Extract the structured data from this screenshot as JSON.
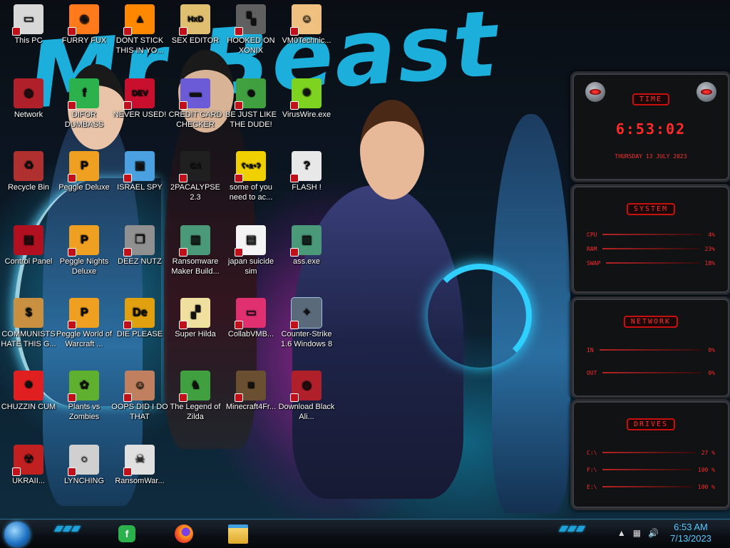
{
  "wallpaper": {
    "headline": "Mr Beast"
  },
  "desktop_icons": [
    {
      "label": "This PC",
      "icon": "computer-icon",
      "color": "#d8d8d8"
    },
    {
      "label": "FURRY FUX",
      "icon": "firefox-icon",
      "color": "#ff7a1a"
    },
    {
      "label": "DONT STICK THIS IN YO...",
      "icon": "vlc-cone-icon",
      "color": "#ff8800"
    },
    {
      "label": "SEX EDITOR",
      "icon": "hex-editor-icon",
      "color": "#e0c070"
    },
    {
      "label": "HOOKED ON XONIX",
      "icon": "xonix-game-icon",
      "color": "#606060"
    },
    {
      "label": "VM0Technic...",
      "icon": "doctor-person-icon",
      "color": "#f0c080"
    },
    {
      "label": "Network",
      "icon": "alienware-network-icon",
      "color": "#b0202a"
    },
    {
      "label": "DIFOR DUMBASS",
      "icon": "feedly-icon",
      "color": "#2bb24c"
    },
    {
      "label": "NEVER USED!",
      "icon": "dev-cpp-icon",
      "color": "#c8102e"
    },
    {
      "label": "CREDIT CARD CHECKER",
      "icon": "credit-card-window-icon",
      "color": "#6b5bd6"
    },
    {
      "label": "BE JUST LIKE THE DUDE!",
      "icon": "santa-icon",
      "color": "#40a040"
    },
    {
      "label": "VirusWire.exe",
      "icon": "lime-icon",
      "color": "#7ed321"
    },
    {
      "label": "Recycle Bin",
      "icon": "recycle-bin-icon",
      "color": "#b03030"
    },
    {
      "label": "Peggle Deluxe",
      "icon": "peggle-icon",
      "color": "#f0a020"
    },
    {
      "label": "ISRAEL SPY",
      "icon": "spy-window-icon",
      "color": "#4aa0e0"
    },
    {
      "label": "2PACALYPSE 2.3",
      "icon": "terminal-icon",
      "color": "#202020"
    },
    {
      "label": "some of you need to ac...",
      "icon": "bear-icon",
      "color": "#f0d000"
    },
    {
      "label": "FLASH !",
      "icon": "flash-document-icon",
      "color": "#e8e8e8"
    },
    {
      "label": "Control Panel",
      "icon": "control-panel-icon",
      "color": "#b01020"
    },
    {
      "label": "Peggle Nights Deluxe",
      "icon": "peggle-nights-icon",
      "color": "#f0a020"
    },
    {
      "label": "DEEZ NUTZ",
      "icon": "stacked-windows-icon",
      "color": "#909090"
    },
    {
      "label": "Ransomware Maker Build...",
      "icon": "ransomware-window-icon",
      "color": "#4a9a7a"
    },
    {
      "label": "japan suicide sim",
      "icon": "document-icon",
      "color": "#f4f4f4"
    },
    {
      "label": "ass.exe",
      "icon": "application-window-icon",
      "color": "#4a9a7a"
    },
    {
      "label": "COMMUNISTS HATE THIS G...",
      "icon": "money-bag-icon",
      "color": "#c89040"
    },
    {
      "label": "Peggle World of Warcraft ...",
      "icon": "peggle-wow-icon",
      "color": "#f0a020"
    },
    {
      "label": "DIE PLEASE",
      "icon": "de-icon",
      "color": "#e0a010"
    },
    {
      "label": "Super Hilda",
      "icon": "pixel-game-icon",
      "color": "#f0e0a0"
    },
    {
      "label": "CollabVMB...",
      "icon": "collabvm-monitor-icon",
      "color": "#e03070"
    },
    {
      "label": "Counter-Strike 1.6 Windows 8",
      "icon": "counter-strike-icon",
      "color": "#5a6a7a"
    },
    {
      "label": "CHUZZIN CUM",
      "icon": "chuzzle-icon",
      "color": "#e02020"
    },
    {
      "label": "Plants vs Zombies",
      "icon": "plants-vs-zombies-icon",
      "color": "#60b030"
    },
    {
      "label": "OOPS DID I DO THAT",
      "icon": "portrait-icon",
      "color": "#c08060"
    },
    {
      "label": "The Legend of Zilda",
      "icon": "pixel-hero-icon",
      "color": "#40a040"
    },
    {
      "label": "Minecraft4Fr...",
      "icon": "minecraft-block-icon",
      "color": "#6a5030"
    },
    {
      "label": "Download Black Ali...",
      "icon": "alienware-sphere-icon",
      "color": "#b0202a"
    },
    {
      "label": "UKRAII...",
      "icon": "radiation-icon",
      "color": "#c02020"
    },
    {
      "label": "LYNCHING",
      "icon": "noose-icon",
      "color": "#d0d0d0"
    },
    {
      "label": "RansomWar...",
      "icon": "skull-icon",
      "color": "#e0e0e0"
    }
  ],
  "gadgets": {
    "time": {
      "title": "TIME",
      "clock": "6:53:02",
      "date": "THURSDAY 13 JULY 2023"
    },
    "system": {
      "title": "SYSTEM",
      "rows": [
        {
          "label": "CPU",
          "value": "4%"
        },
        {
          "label": "RAM",
          "value": "23%"
        },
        {
          "label": "SWAP",
          "value": "18%"
        }
      ]
    },
    "network": {
      "title": "NETWORK",
      "rows": [
        {
          "label": "IN",
          "value": "0%"
        },
        {
          "label": "OUT",
          "value": "0%"
        }
      ]
    },
    "drives": {
      "title": "DRIVES",
      "rows": [
        {
          "label": "C:\\",
          "value": "27 %"
        },
        {
          "label": "F:\\",
          "value": "100 %"
        },
        {
          "label": "E:\\",
          "value": "100 %"
        }
      ]
    }
  },
  "taskbar": {
    "pinned": [
      "feedly-icon",
      "firefox-icon",
      "file-explorer-icon"
    ],
    "clock_time": "6:53 AM",
    "clock_date": "7/13/2023"
  },
  "colors": {
    "accent_blue": "#1fb8e6",
    "gadget_red": "#ff2a2a",
    "clock_blue": "#59c9ff"
  }
}
